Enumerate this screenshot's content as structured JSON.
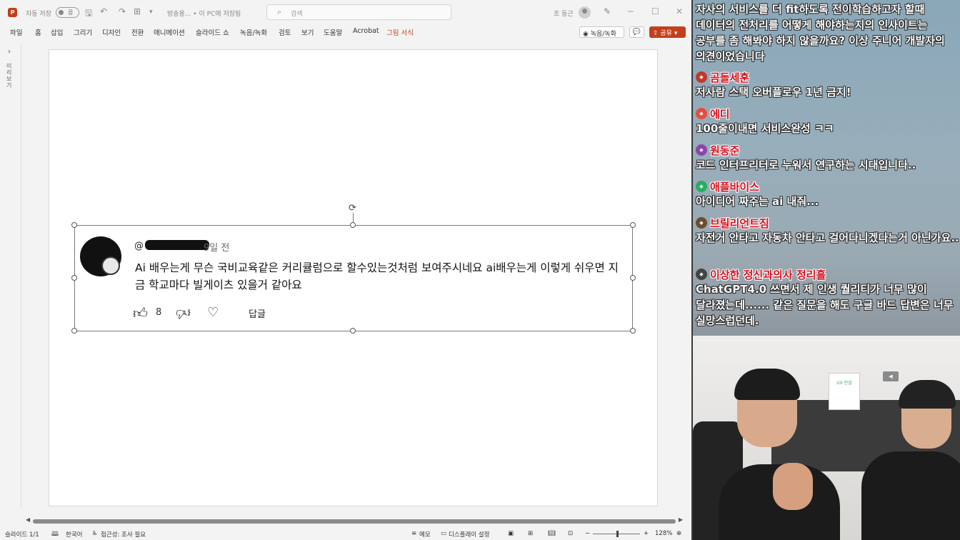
{
  "window": {
    "app_icon": "P",
    "autosave_label": "자동 저장",
    "autosave_state": "끔",
    "doc_title": "방송용... • 이 PC에 저장됨",
    "search_placeholder": "검색",
    "user_name": "조 동근",
    "controls": [
      "─",
      "☐",
      "✕"
    ]
  },
  "ribbon": {
    "tabs": [
      "파일",
      "홈",
      "삽입",
      "그리기",
      "디자인",
      "전환",
      "애니메이션",
      "슬라이드 쇼",
      "녹음/녹화",
      "검토",
      "보기",
      "도움말",
      "Acrobat",
      "그림 서식"
    ],
    "record_label": "◉ 녹음/녹화",
    "comment_icon": "💬",
    "share_label": "⇪ 공유 ▾"
  },
  "leftpane": {
    "expand_icon": "›",
    "label": "미리보기"
  },
  "comment": {
    "handle_prefix": "@",
    "time": "9일 전",
    "text": "Ai 배우는게 무슨 국비교육같은 커리큘럼으로 할수있는것처럼 보여주시네요 ai배우는게 이렇게 쉬우면 지금 학교마다 빌게이츠 있을거 같아요",
    "like_count": "8",
    "reply_label": "답글"
  },
  "status": {
    "slide": "슬라이드 1/1",
    "language": "한국어",
    "accessibility": "접근성: 조사 필요",
    "notes": "메모",
    "display": "디스플레이 설정",
    "zoom_minus": "−",
    "zoom_plus": "+",
    "zoom": "128%"
  },
  "chat": {
    "intro_text": "자사의 서비스를 더 fit하도록 전이학습하고자 할때 데이터의 전처리를 어떻게 해야하는지의 인사이트는 공부를 좀 해봐야 하지 않을까요? 이상 주니어 개발자의 의견이었습니다",
    "messages": [
      {
        "user": "곰돌세훈",
        "text": "저사람 스택 오버플로우 1년 금지!",
        "badge_color": "#c0392b"
      },
      {
        "user": "에디",
        "text": "100줄이내면 서비스완성 ㅋㅋ",
        "badge_color": "#e74c3c"
      },
      {
        "user": "원동준",
        "text": "코드 인터프리터로 누워서 연구하는 시대입니다..",
        "badge_color": "#8e44ad"
      },
      {
        "user": "애플바이스",
        "text": "아이디어 짜주는 ai 내줘...",
        "badge_color": "#27ae60"
      },
      {
        "user": "브릴리언트짐",
        "text": "자전거 안타고 자동차 안타고 걸어다니겠다는거 아닌가요..",
        "badge_color": "#6d4c2f"
      },
      {
        "user": "이상한 정신과의사 정리흘",
        "text": "ChatGPT4.0 쓰면서 제 인생 퀄리티가 너무 많이 달라졌는데...... 같은 질문을 해도 구글 바드 답변은 너무 실망스럽던데.",
        "badge_color": "#444444"
      }
    ]
  },
  "webcam": {
    "sign_text": "UX 전설",
    "tag_text": "◀"
  }
}
